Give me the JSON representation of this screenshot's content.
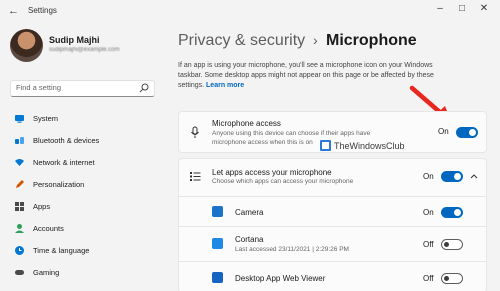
{
  "window": {
    "title": "Settings",
    "back_icon": "back-arrow-icon",
    "controls": [
      "minimize-icon",
      "maximize-icon",
      "close-icon"
    ]
  },
  "user": {
    "name": "Sudip Majhi",
    "email": "sudipmajhi@example.com"
  },
  "search": {
    "placeholder": "Find a setting",
    "icon": "search-icon"
  },
  "sidebar": {
    "items": [
      {
        "label": "System",
        "icon": "system-icon",
        "color": "#0078d4"
      },
      {
        "label": "Bluetooth & devices",
        "icon": "bluetooth-icon",
        "color": "#0078d4"
      },
      {
        "label": "Network & internet",
        "icon": "wifi-icon",
        "color": "#0078d4"
      },
      {
        "label": "Personalization",
        "icon": "pencil-icon",
        "color": "#d35400"
      },
      {
        "label": "Apps",
        "icon": "apps-icon",
        "color": "#4a4a4a"
      },
      {
        "label": "Accounts",
        "icon": "person-icon",
        "color": "#2e9e5b"
      },
      {
        "label": "Time & language",
        "icon": "globe-clock-icon",
        "color": "#0078d4"
      },
      {
        "label": "Gaming",
        "icon": "controller-icon",
        "color": "#4a4a4a"
      }
    ]
  },
  "header": {
    "parent": "Privacy & security",
    "separator": "›",
    "current": "Microphone"
  },
  "intro": {
    "line1": "If an app is using your microphone, you'll see a microphone icon on your Windows",
    "line2": "taskbar. Some desktop apps might not appear on this page or be affected by these",
    "line3_prefix": "settings.",
    "learn_more": "Learn more"
  },
  "microphone_access": {
    "icon": "microphone-icon",
    "title": "Microphone access",
    "desc1": "Anyone using this device can choose if their apps have",
    "desc2": "microphone access when this is on",
    "state": "On",
    "checked": true
  },
  "apps_access": {
    "icon": "list-icon",
    "title": "Let apps access your microphone",
    "desc": "Choose which apps can access your microphone",
    "state": "On",
    "checked": true,
    "expand_icon": "chevron-up-icon"
  },
  "apps": [
    {
      "name": "Camera",
      "sub": "",
      "state": "On",
      "checked": true,
      "icon": "camera-icon",
      "color": "#1a73c8"
    },
    {
      "name": "Cortana",
      "sub": "Last accessed 23/11/2021  |  2:29:26 PM",
      "state": "Off",
      "checked": false,
      "icon": "cortana-icon",
      "color": "#1e88e5"
    },
    {
      "name": "Desktop App Web Viewer",
      "sub": "",
      "state": "Off",
      "checked": false,
      "icon": "desktop-app-icon",
      "color": "#1565c0"
    }
  ],
  "watermark": "TheWindowsClub",
  "accent": "#0067c0",
  "annotation_arrow_color": "#e8281e"
}
